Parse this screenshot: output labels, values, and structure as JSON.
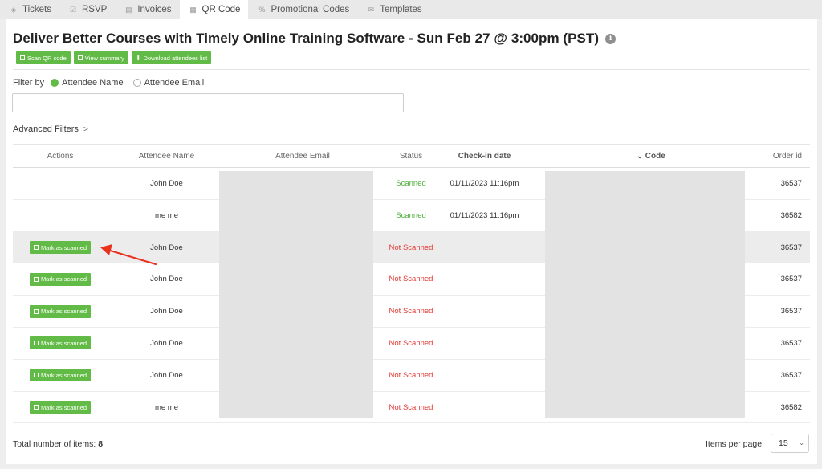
{
  "tabs": [
    {
      "label": "Tickets",
      "icon": "ticket-icon"
    },
    {
      "label": "RSVP",
      "icon": "checkbox-icon"
    },
    {
      "label": "Invoices",
      "icon": "document-icon"
    },
    {
      "label": "QR Code",
      "icon": "qr-icon",
      "active": true
    },
    {
      "label": "Promotional Codes",
      "icon": "percent-icon"
    },
    {
      "label": "Templates",
      "icon": "envelope-icon"
    }
  ],
  "header": {
    "title": "Deliver Better Courses with Timely Online Training Software - Sun Feb 27 @ 3:00pm (PST)",
    "buttons": {
      "scan": "Scan QR code",
      "summary": "View summary",
      "download": "Download attendees list"
    }
  },
  "filter": {
    "label": "Filter by",
    "options": [
      "Attendee Name",
      "Attendee Email"
    ],
    "selected": "Attendee Name",
    "search_value": "",
    "advanced_label": "Advanced Filters"
  },
  "table": {
    "columns": {
      "actions": "Actions",
      "name": "Attendee Name",
      "email": "Attendee Email",
      "status": "Status",
      "checkin": "Check-in date",
      "code": "Code",
      "order": "Order id"
    },
    "action_label": "Mark as scanned",
    "rows": [
      {
        "name": "John Doe",
        "status": "Scanned",
        "checkin": "01/11/2023 11:16pm",
        "order": "36537"
      },
      {
        "name": "me me",
        "status": "Scanned",
        "checkin": "01/11/2023 11:16pm",
        "order": "36582"
      },
      {
        "name": "John Doe",
        "status": "Not Scanned",
        "checkin": "",
        "order": "36537"
      },
      {
        "name": "John Doe",
        "status": "Not Scanned",
        "checkin": "",
        "order": "36537"
      },
      {
        "name": "John Doe",
        "status": "Not Scanned",
        "checkin": "",
        "order": "36537"
      },
      {
        "name": "John Doe",
        "status": "Not Scanned",
        "checkin": "",
        "order": "36537"
      },
      {
        "name": "John Doe",
        "status": "Not Scanned",
        "checkin": "",
        "order": "36537"
      },
      {
        "name": "me me",
        "status": "Not Scanned",
        "checkin": "",
        "order": "36582"
      }
    ]
  },
  "footer": {
    "total_label": "Total number of items:",
    "total_value": "8",
    "ipp_label": "Items per page",
    "ipp_value": "15"
  },
  "colors": {
    "accent": "#62bb46",
    "scanned": "#4caf3a",
    "not_scanned": "#e53935",
    "arrow": "#e8321e"
  }
}
